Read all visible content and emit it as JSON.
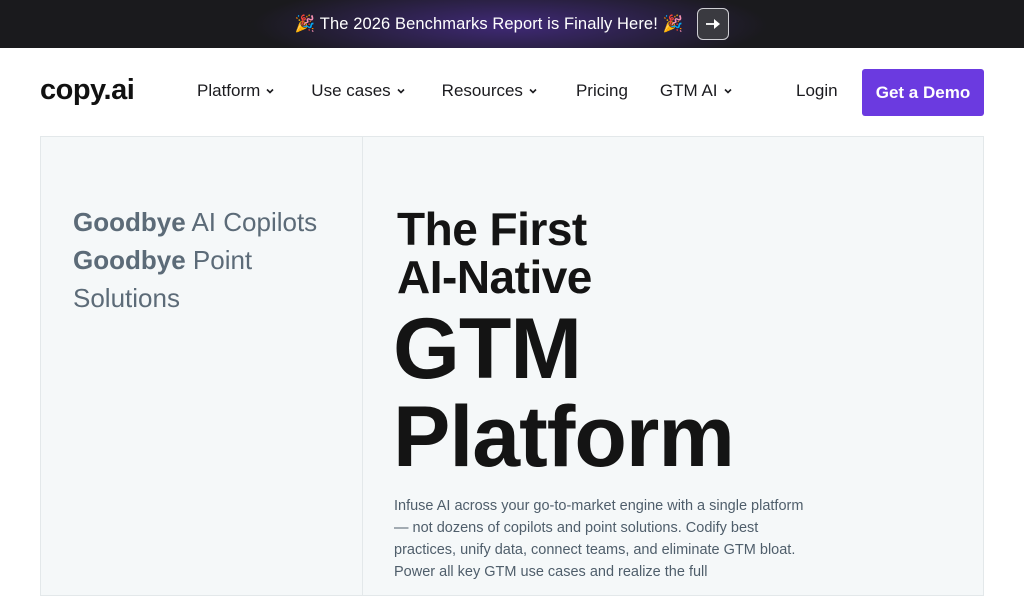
{
  "announcement": {
    "text": "🎉 The 2026 Benchmarks Report is Finally Here! 🎉",
    "arrow_icon": "arrow-right-icon"
  },
  "nav": {
    "logo": "copy.ai",
    "items": [
      {
        "label": "Platform",
        "has_dropdown": true
      },
      {
        "label": "Use cases",
        "has_dropdown": true
      },
      {
        "label": "Resources",
        "has_dropdown": true
      },
      {
        "label": "Pricing",
        "has_dropdown": false
      },
      {
        "label": "GTM AI",
        "has_dropdown": true
      }
    ],
    "login": "Login",
    "cta": "Get a Demo"
  },
  "hero": {
    "goodbye_1_bold": "Goodbye",
    "goodbye_1_rest": " AI Copilots",
    "goodbye_2_bold": "Goodbye",
    "goodbye_2_rest": " Point Solutions",
    "heading_line1": "The First",
    "heading_line2": "AI-Native",
    "heading_line3": "GTM",
    "heading_line4": "Platform",
    "description": "Infuse AI across your go-to-market engine with a single platform — not dozens of copilots and point solutions. Codify best practices, unify data, connect teams, and eliminate GTM bloat. Power all key GTM use cases and realize the full"
  },
  "colors": {
    "accent": "#6b3ae0",
    "announce_bg": "#1a1a1d",
    "hero_bg": "#f5f8f9",
    "muted_text": "#5c6b78"
  }
}
